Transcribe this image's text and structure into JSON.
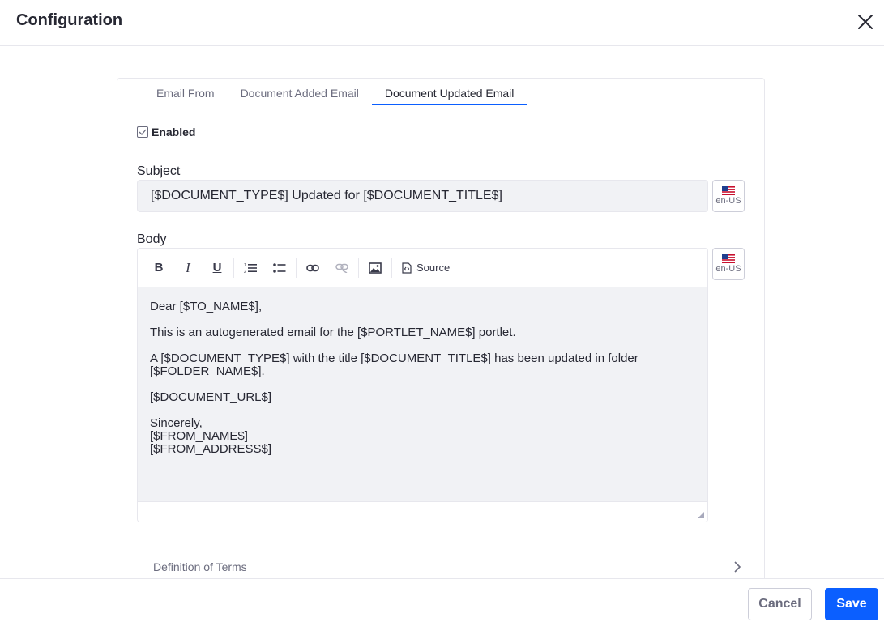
{
  "header": {
    "title": "Configuration"
  },
  "tabs": [
    {
      "label": "Email From",
      "active": false
    },
    {
      "label": "Document Added Email",
      "active": false
    },
    {
      "label": "Document Updated Email",
      "active": true
    }
  ],
  "enabled": {
    "label": "Enabled",
    "checked": true
  },
  "subject": {
    "label": "Subject",
    "value": "[$DOCUMENT_TYPE$] Updated for [$DOCUMENT_TITLE$]",
    "locale": "en-US"
  },
  "body": {
    "label": "Body",
    "locale": "en-US",
    "toolbar": {
      "source_label": "Source"
    },
    "paragraphs": [
      [
        "Dear [$TO_NAME$],"
      ],
      [
        "This is an autogenerated email for the [$PORTLET_NAME$] portlet."
      ],
      [
        "A [$DOCUMENT_TYPE$] with the title [$DOCUMENT_TITLE$] has been updated in folder",
        "[$FOLDER_NAME$]."
      ],
      [
        "[$DOCUMENT_URL$]"
      ],
      [
        "Sincerely,",
        "[$FROM_NAME$]",
        "[$FROM_ADDRESS$]"
      ]
    ]
  },
  "terms": {
    "label": "Definition of Terms"
  },
  "footer": {
    "cancel_label": "Cancel",
    "save_label": "Save"
  },
  "colors": {
    "primary": "#0b5fff",
    "border": "#e7e7ed",
    "input_bg": "#f1f2f5"
  }
}
